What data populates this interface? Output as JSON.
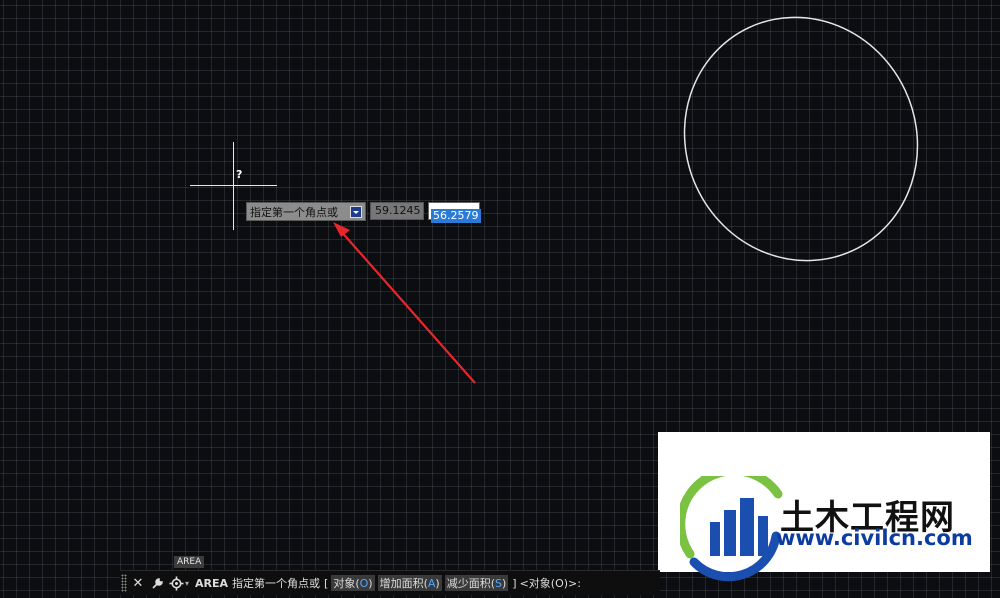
{
  "canvas": {
    "cursor_marker": "?",
    "annotation_arrow_color": "#e8262c",
    "ellipse_color": "#e6e6e6"
  },
  "dynamic_input": {
    "prompt": "指定第一个角点或",
    "x_value": "59.1245",
    "y_value": "56.2579",
    "dropdown_icon": "chevron-down-icon"
  },
  "command_line": {
    "tag": "AREA",
    "command": "AREA",
    "prompt": "指定第一个角点或",
    "bracket_open": "[",
    "options": [
      {
        "label": "对象(",
        "key": "O",
        "close": ")"
      },
      {
        "label": "增加面积(",
        "key": "A",
        "close": ")"
      },
      {
        "label": "减少面积(",
        "key": "S",
        "close": ")"
      }
    ],
    "bracket_close": "]",
    "default_text": "<对象(O)>:",
    "icons": [
      "close-icon",
      "wrench-icon",
      "gear-icon"
    ]
  },
  "watermark": {
    "title": "土木工程网",
    "url": "www.civilcn.com"
  },
  "colors": {
    "background": "#0b0d10",
    "highlight": "#2a7bd8",
    "option_key": "#4fa8ff"
  }
}
